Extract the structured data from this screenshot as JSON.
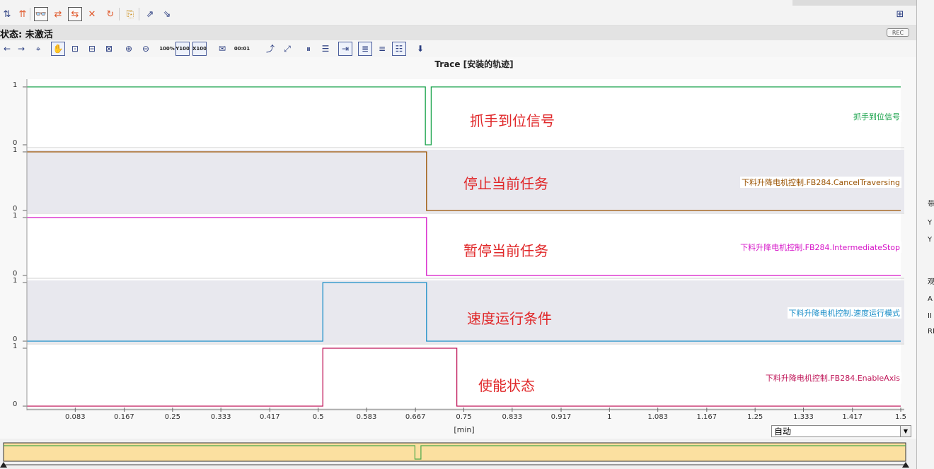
{
  "toolbar": {
    "buttons": [
      {
        "name": "download-trace-icon",
        "glyph": "⇅"
      },
      {
        "name": "upload-trace-icon",
        "glyph": "⇈"
      },
      {
        "name": "observe-on-icon",
        "glyph": "👓"
      },
      {
        "name": "record-start-icon",
        "glyph": "⇄"
      },
      {
        "name": "record-active-icon",
        "glyph": "⇆"
      },
      {
        "name": "delete-record-icon",
        "glyph": "✕"
      },
      {
        "name": "refresh-icon",
        "glyph": "↻"
      },
      {
        "name": "export-icon",
        "glyph": "⎘"
      },
      {
        "name": "save-measurement-icon",
        "glyph": "⇗"
      },
      {
        "name": "load-measurement-icon",
        "glyph": "⇘"
      }
    ],
    "layout_icon": "⊞"
  },
  "status": {
    "text": "状态: 未激活",
    "rec_label": "REC"
  },
  "toolbar2": {
    "icons": [
      {
        "name": "back-icon",
        "glyph": "←"
      },
      {
        "name": "forward-icon",
        "glyph": "→"
      },
      {
        "name": "crosshair-icon",
        "glyph": "⌖"
      },
      {
        "name": "hand-pan-icon",
        "glyph": "✋"
      },
      {
        "name": "zoom-region-icon",
        "glyph": "⊡"
      },
      {
        "name": "zoom-horizontal-icon",
        "glyph": "⊟"
      },
      {
        "name": "zoom-vertical-icon",
        "glyph": "⊠"
      },
      {
        "name": "zoom-in-icon",
        "glyph": "⊕"
      },
      {
        "name": "zoom-out-icon",
        "glyph": "⊖"
      },
      {
        "name": "zoom-100-icon",
        "glyph": "100%"
      },
      {
        "name": "zoom-y-100-icon",
        "glyph": "Y100"
      },
      {
        "name": "zoom-x-100-icon",
        "glyph": "X100"
      },
      {
        "name": "envelope-icon",
        "glyph": "✉"
      },
      {
        "name": "sample-interval-icon",
        "glyph": "00:01"
      },
      {
        "name": "trend-icon",
        "glyph": "⤴"
      },
      {
        "name": "diagonal-icon",
        "glyph": "⤢"
      },
      {
        "name": "vertical-cursor-icon",
        "glyph": "⏸"
      },
      {
        "name": "horizontal-cursor-icon",
        "glyph": "☰"
      },
      {
        "name": "cursor-data-icon",
        "glyph": "⇥"
      },
      {
        "name": "list-view-icon",
        "glyph": "≣"
      },
      {
        "name": "align-left-icon",
        "glyph": "≡"
      },
      {
        "name": "align-full-icon",
        "glyph": "☷"
      },
      {
        "name": "import-icon",
        "glyph": "⬇"
      }
    ]
  },
  "chart_data": {
    "type": "line",
    "title": "Trace [安装的轨迹]",
    "xlabel": "[min]",
    "xlim": [
      0,
      1.5
    ],
    "x_ticks": [
      "0.083",
      "0.167",
      "0.25",
      "0.333",
      "0.417",
      "0.5",
      "0.583",
      "0.667",
      "0.75",
      "0.833",
      "0.917",
      "1",
      "1.083",
      "1.167",
      "1.25",
      "1.333",
      "1.417",
      "1.5"
    ],
    "series": [
      {
        "legend": "抓手到位信号",
        "annotation": "抓手到位信号",
        "color": "#18a24a",
        "shaded": false,
        "steps": [
          [
            0,
            1
          ],
          [
            0.684,
            0
          ],
          [
            0.694,
            1
          ],
          [
            1.5,
            1
          ]
        ]
      },
      {
        "legend": "下料升降电机控制.FB284.CancelTraversing",
        "annotation": "停止当前任务",
        "color": "#9a5200",
        "shaded": true,
        "steps": [
          [
            0,
            1
          ],
          [
            0.686,
            0
          ],
          [
            1.5,
            0
          ]
        ]
      },
      {
        "legend": "下料升降电机控制.FB284.IntermediateStop",
        "annotation": "暂停当前任务",
        "color": "#d615c8",
        "shaded": false,
        "steps": [
          [
            0,
            1
          ],
          [
            0.686,
            0
          ],
          [
            1.5,
            0
          ]
        ]
      },
      {
        "legend": "下料升降电机控制.速度运行模式",
        "annotation": "速度运行条件",
        "color": "#1a8ec8",
        "shaded": true,
        "steps": [
          [
            0,
            0
          ],
          [
            0.508,
            1
          ],
          [
            0.686,
            0
          ],
          [
            1.5,
            0
          ]
        ]
      },
      {
        "legend": "下料升降电机控制.FB284.EnableAxis",
        "annotation": "使能状态",
        "color": "#c0185a",
        "shaded": false,
        "steps": [
          [
            0,
            0
          ],
          [
            0.508,
            1
          ],
          [
            0.738,
            0
          ],
          [
            1.5,
            0
          ]
        ]
      }
    ],
    "y_ticks": [
      "0",
      "1"
    ],
    "grid": false
  },
  "mode_select": {
    "value": "自动"
  },
  "right_panel": {
    "labels": [
      "带",
      "Y",
      "Y",
      "观",
      "A",
      "II",
      "RM"
    ]
  }
}
